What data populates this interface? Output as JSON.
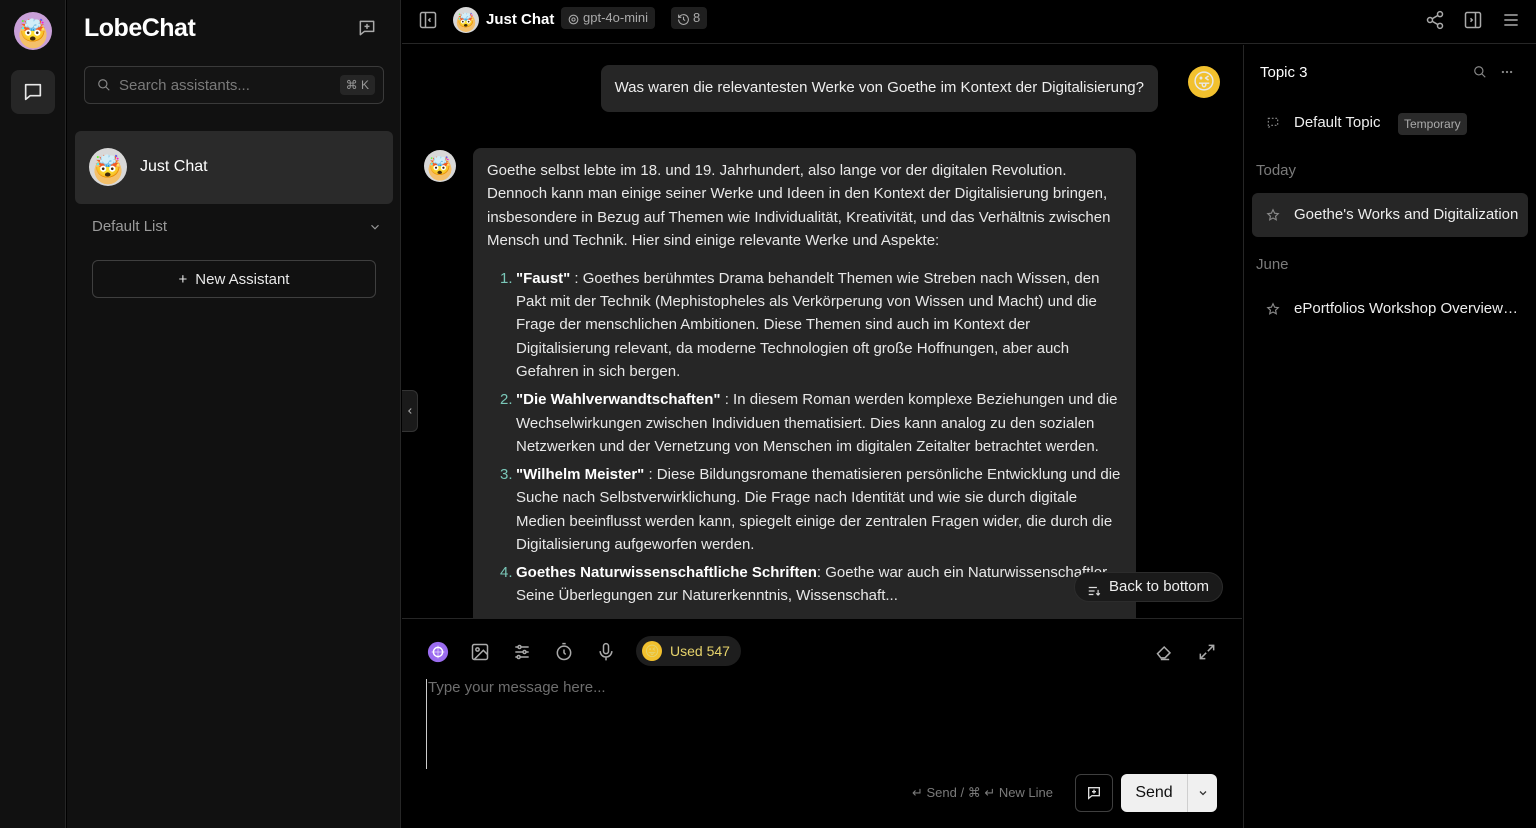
{
  "app": {
    "brand": "LobeChat"
  },
  "sidebar": {
    "search_placeholder": "Search assistants...",
    "search_shortcut": "⌘ K",
    "sessions": [
      {
        "title": "Just Chat"
      }
    ],
    "group_label": "Default List",
    "new_assistant_label": "New Assistant"
  },
  "header": {
    "title": "Just Chat",
    "model": "gpt-4o-mini",
    "history_count": "8"
  },
  "chat": {
    "user_message": "Was waren die relevantesten Werke von Goethe im Kontext der Digitalisierung?",
    "assistant_intro": "Goethe selbst lebte im 18. und 19. Jahrhundert, also lange vor der digitalen Revolution. Dennoch kann man einige seiner Werke und Ideen in den Kontext der Digitalisierung bringen, insbesondere in Bezug auf Themen wie Individualität, Kreativität, und das Verhältnis zwischen Mensch und Technik. Hier sind einige relevante Werke und Aspekte:",
    "items": [
      {
        "num": "1.",
        "title": "\"Faust\"",
        "text": " : Goethes berühmtes Drama behandelt Themen wie Streben nach Wissen, den Pakt mit der Technik (Mephistopheles als Verkörperung von Wissen und Macht) und die Frage der menschlichen Ambitionen. Diese Themen sind auch im Kontext der Digitalisierung relevant, da moderne Technologien oft große Hoffnungen, aber auch Gefahren in sich bergen."
      },
      {
        "num": "2.",
        "title": "\"Die Wahlverwandtschaften\"",
        "text": " : In diesem Roman werden komplexe Beziehungen und die Wechselwirkungen zwischen Individuen thematisiert. Dies kann analog zu den sozialen Netzwerken und der Vernetzung von Menschen im digitalen Zeitalter betrachtet werden."
      },
      {
        "num": "3.",
        "title": "\"Wilhelm Meister\"",
        "text": " : Diese Bildungsromane thematisieren persönliche Entwicklung und die Suche nach Selbstverwirklichung. Die Frage nach Identität und wie sie durch digitale Medien beeinflusst werden kann, spiegelt einige der zentralen Fragen wider, die durch die Digitalisierung aufgeworfen werden."
      },
      {
        "num": "4.",
        "title": "Goethes Naturwissenschaftliche Schriften",
        "text": ": Goethe war auch ein Naturwissenschaftler. Seine Überlegungen zur Naturerkenntnis, Wissenschaft..."
      }
    ],
    "back_to_bottom": "Back to bottom"
  },
  "input": {
    "used_label": "Used 547",
    "placeholder": "Type your message here...",
    "hint": "↵ Send / ⌘ ↵ New Line",
    "send_label": "Send"
  },
  "topics": {
    "title": "Topic 3",
    "default_topic": "Default Topic",
    "default_tag": "Temporary",
    "groups": [
      {
        "label": "Today",
        "items": [
          "Goethe's Works and Digitalization"
        ]
      },
      {
        "label": "June",
        "items": [
          "ePortfolios Workshop Overview and Goals"
        ]
      }
    ]
  },
  "colors": {
    "accent_purple": "#9b6cf0",
    "list_number": "#7ac7b8",
    "used_text": "#e6d36b"
  }
}
